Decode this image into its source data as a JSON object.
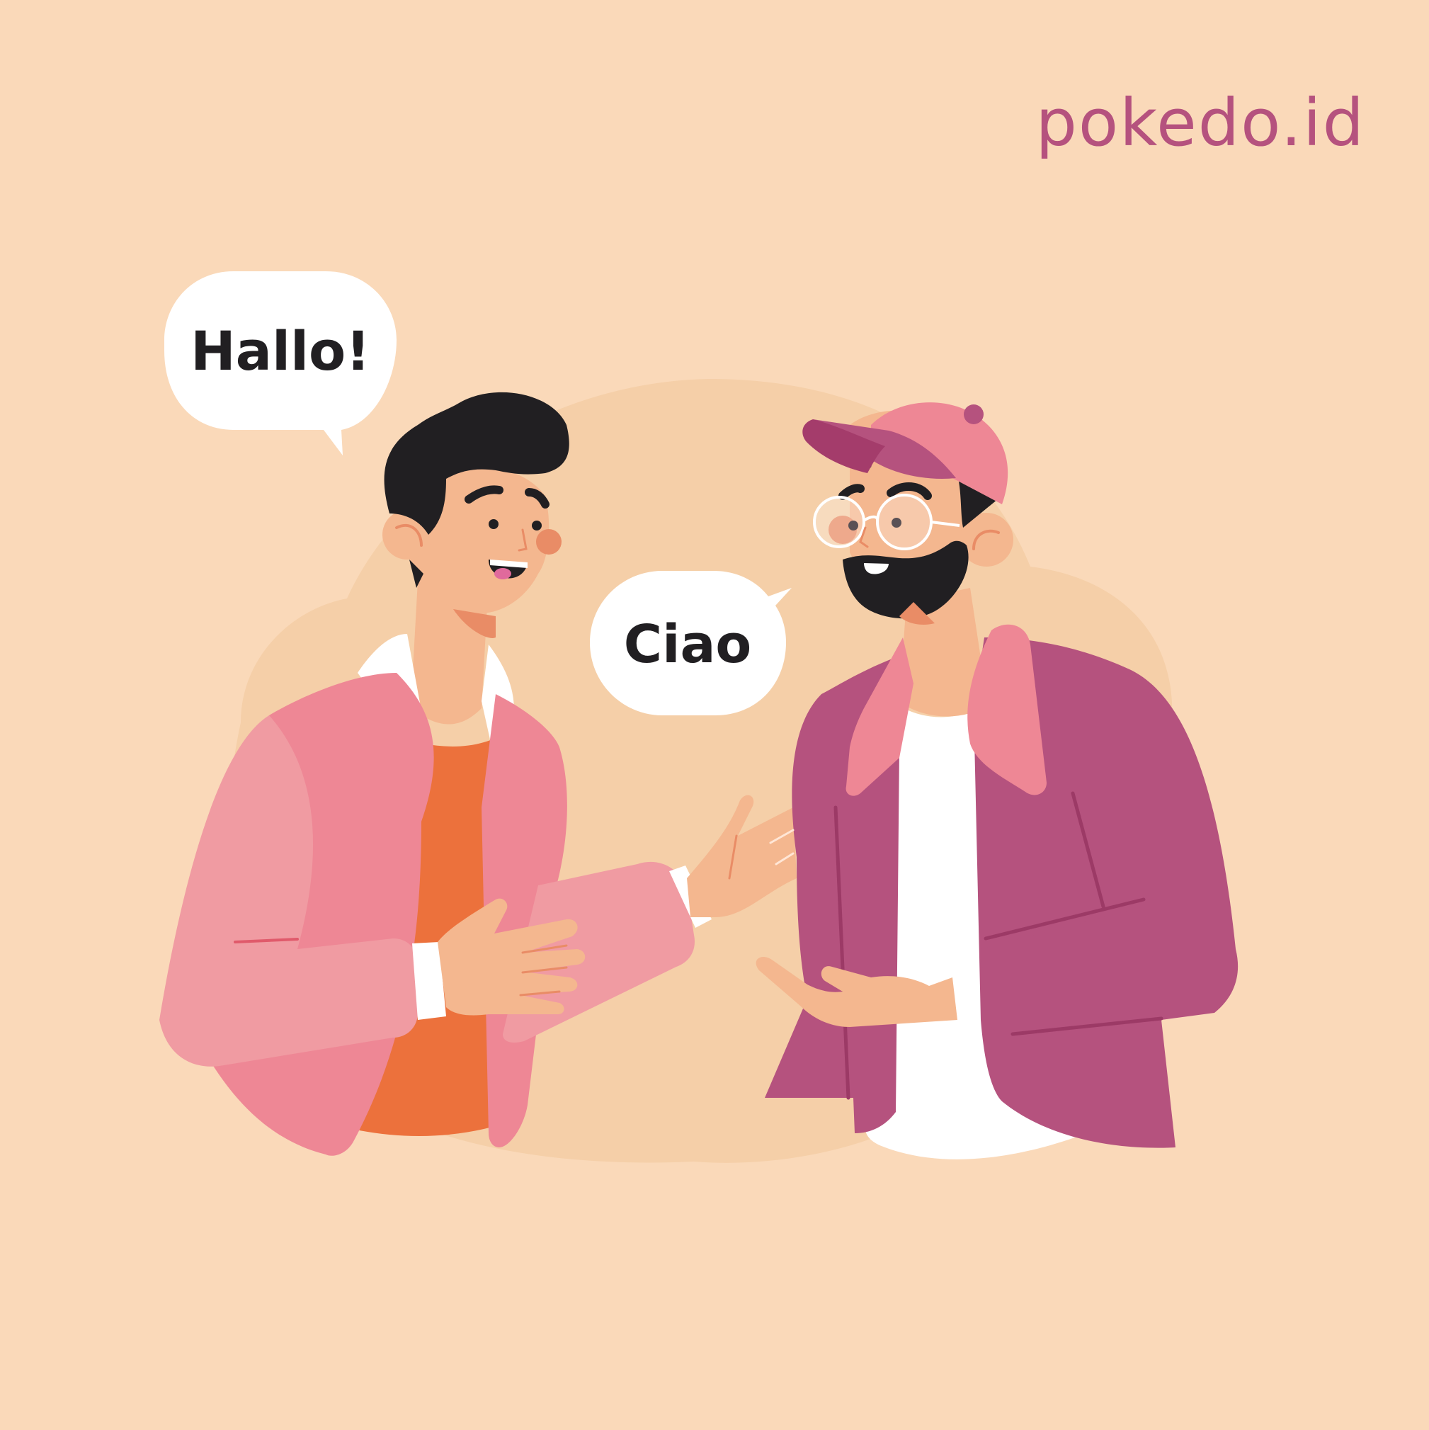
{
  "brand": {
    "name": "pokedo.id"
  },
  "bubbles": {
    "left": "Hallo!",
    "right": "Ciao"
  },
  "colors": {
    "background": "#FAD9B9",
    "backdrop": "#F5CFA8",
    "skin": "#F4B78F",
    "hair": "#211F22",
    "left_jacket": "#EE8795",
    "left_sleeve": "#F09BA2",
    "left_shirt": "#EC713C",
    "right_jacket": "#B5527E",
    "right_collar": "#EE8795",
    "cap": "#EE8795",
    "white": "#FFFFFF",
    "brand": "#B5527E"
  }
}
